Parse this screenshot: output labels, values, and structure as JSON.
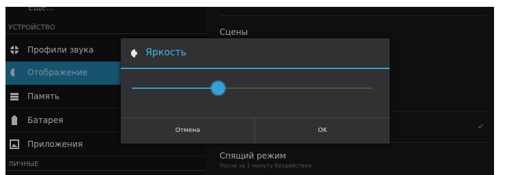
{
  "left_panel": {
    "more_label": "Еще...",
    "section_device": "УСТРОЙСТВО",
    "section_personal": "ЛИЧНЫЕ",
    "items": [
      {
        "label": "Профили звука",
        "icon": "sound-profile-icon"
      },
      {
        "label": "Отображение",
        "icon": "display-icon"
      },
      {
        "label": "Память",
        "icon": "storage-icon"
      },
      {
        "label": "Батарея",
        "icon": "battery-icon"
      },
      {
        "label": "Приложения",
        "icon": "apps-icon"
      }
    ],
    "active_index": 1
  },
  "right_panel": {
    "scenes_label": "Сцены",
    "sleep_title": "Спящий режим",
    "sleep_subtitle": "После за 1 минуту бездействия"
  },
  "dialog": {
    "title": "Яркость",
    "icon": "brightness-icon",
    "brightness_level": 0.36,
    "cancel_label": "Отмена",
    "ok_label": "OK"
  },
  "colors": {
    "accent": "#3a9ed1",
    "active_item_bg": "#1f6f93",
    "background": "#141414"
  }
}
